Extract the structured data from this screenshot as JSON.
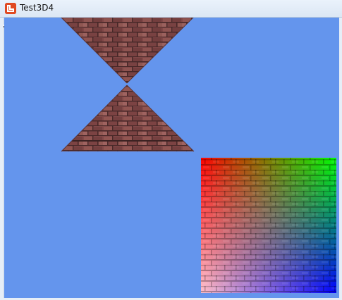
{
  "window": {
    "title": "Test3D4",
    "icon": "monogame-logo-icon"
  },
  "scene": {
    "clear_color": "#6495ed",
    "brick_texture_colors": [
      "#8a4e4e",
      "#6f3d3d",
      "#a96a66",
      "#4e2c2c"
    ],
    "objects": [
      {
        "name": "textured-pyramid-inverted",
        "shape": "triangle-down"
      },
      {
        "name": "textured-pyramid-upright",
        "shape": "triangle-up"
      },
      {
        "name": "vertex-colored-quad",
        "shape": "square",
        "corner_colors": {
          "top_left": "#ff0000",
          "top_right": "#00ff00",
          "bottom_left": "#ffc0cb",
          "bottom_right": "#0000ff"
        }
      }
    ]
  }
}
